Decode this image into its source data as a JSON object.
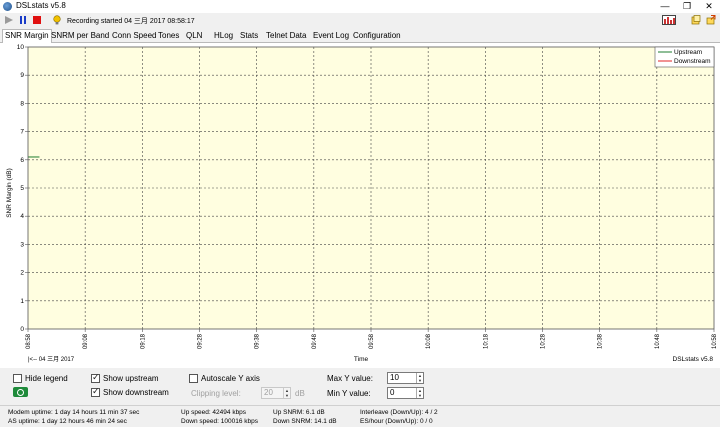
{
  "window": {
    "title": "DSLstats v5.8"
  },
  "toolbar": {
    "recording_text": "Recording started 04 三月 2017 08:58:17"
  },
  "tabs": [
    "SNR Margin",
    "SNRM per Band",
    "Conn Speed",
    "Tones",
    "QLN",
    "HLog",
    "Stats",
    "Telnet Data",
    "Event Log",
    "Configuration"
  ],
  "chart_data": {
    "type": "line",
    "xlabel": "Time",
    "ylabel": "SNR Margin (dB)",
    "ylim": [
      0,
      10
    ],
    "yticks": [
      0,
      1,
      2,
      3,
      4,
      5,
      6,
      7,
      8,
      9,
      10
    ],
    "xticks": [
      "08:58",
      "09:08",
      "09:18",
      "09:28",
      "09:38",
      "09:48",
      "09:58",
      "10:08",
      "10:18",
      "10:28",
      "10:38",
      "10:48",
      "10:58"
    ],
    "date_label": "|<-- 04 三月 2017",
    "watermark": "DSLstats v5.8",
    "grid": true,
    "legend_position": "top-right",
    "series": [
      {
        "name": "Upstream",
        "color": "#1e7d2f",
        "x": [
          "08:58",
          "09:00"
        ],
        "values": [
          6.1,
          6.1
        ]
      },
      {
        "name": "Downstream",
        "color": "#e32626",
        "x": [],
        "values": []
      }
    ],
    "background": "#fffee0"
  },
  "controls": {
    "hide_legend": {
      "label": "Hide legend",
      "checked": false
    },
    "show_upstream": {
      "label": "Show upstream",
      "checked": true
    },
    "show_downstream": {
      "label": "Show downstream",
      "checked": true
    },
    "autoscale": {
      "label": "Autoscale Y axis",
      "checked": false
    },
    "clipping": {
      "label": "Clipping level:",
      "value": "20",
      "unit": "dB"
    },
    "max_y": {
      "label": "Max Y value:",
      "value": "10"
    },
    "min_y": {
      "label": "Min Y value:",
      "value": "0"
    }
  },
  "status": {
    "modem_uptime": "Modem uptime: 1 day 14 hours 11 min 37 sec",
    "as_uptime": "AS uptime: 1 day 12 hours 46 min 24 sec",
    "up_speed": "Up speed: 42494 kbps",
    "down_speed": "Down speed: 100016 kbps",
    "up_snrm": "Up SNRM: 6.1 dB",
    "down_snrm": "Down SNRM: 14.1 dB",
    "interleave": "Interleave (Down/Up): 4 / 2",
    "es_hour": "ES/hour (Down/Up): 0 / 0"
  },
  "colors": {
    "accent_recording": "#d00000",
    "grid_bg": "#fffee0"
  }
}
